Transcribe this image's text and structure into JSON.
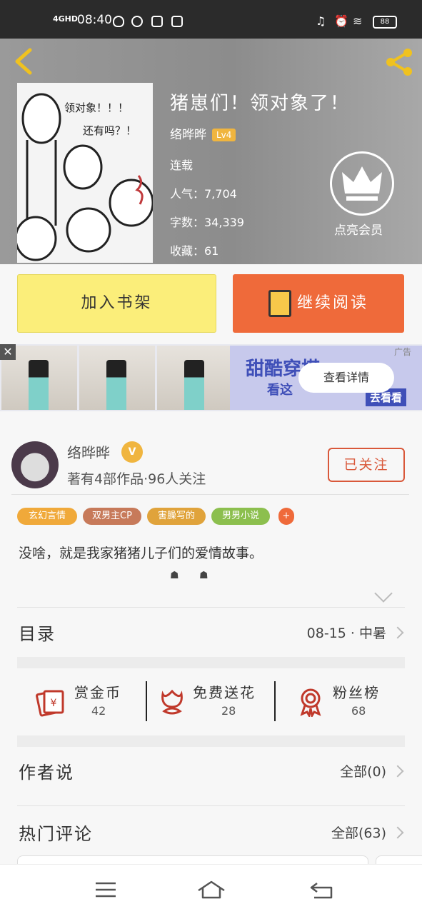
{
  "status_bar": {
    "signal": "4GHD",
    "time": "08:40",
    "battery": "88"
  },
  "book": {
    "title": "猪崽们！领对象了！",
    "author": "络晔晔",
    "level": "Lv4",
    "status": "连载",
    "popularity": "人气：7,704",
    "word_count": "字数：34,339",
    "favorites": "收藏：61",
    "cover_text_line1": "领对象！！！",
    "cover_text_line2": "还有吗？！",
    "vip_label": "点亮会员"
  },
  "actions": {
    "add_shelf": "加入书架",
    "continue_read": "继续阅读"
  },
  "ad": {
    "art_title": "甜酷穿搭",
    "art_sub": "看这",
    "go": "去看看",
    "detail": "查看详情",
    "tag": "广告",
    "close": "✕"
  },
  "author_card": {
    "name": "络晔晔",
    "verified": "V",
    "subtitle": "著有4部作品·96人关注",
    "follow": "已关注",
    "tags": [
      {
        "label": "玄幻言情",
        "color": "#f0a93a"
      },
      {
        "label": "双男主CP",
        "color": "#c77a5a"
      },
      {
        "label": "害臊写的",
        "color": "#e0a33b"
      },
      {
        "label": "男男小说",
        "color": "#8cbf4e"
      },
      {
        "label": "+",
        "color": "#ef6a3a"
      }
    ],
    "description": "没啥，就是我家猪猪儿子们的爱情故事。",
    "dots": "☗ ☗"
  },
  "toc": {
    "label": "目录",
    "latest": "08-15 · 中暑"
  },
  "stats": [
    {
      "name": "赏金币",
      "value": "42",
      "icon": "gold-coin-icon"
    },
    {
      "name": "免费送花",
      "value": "28",
      "icon": "flower-icon"
    },
    {
      "name": "粉丝榜",
      "value": "68",
      "icon": "medal-icon"
    }
  ],
  "author_says": {
    "label": "作者说",
    "link": "全部(0)"
  },
  "hot_comments": {
    "label": "热门评论",
    "link": "全部(63)"
  },
  "colors": {
    "accent": "#ef6a3a",
    "shelf": "#fbee7a",
    "level": "#f0b53f"
  }
}
